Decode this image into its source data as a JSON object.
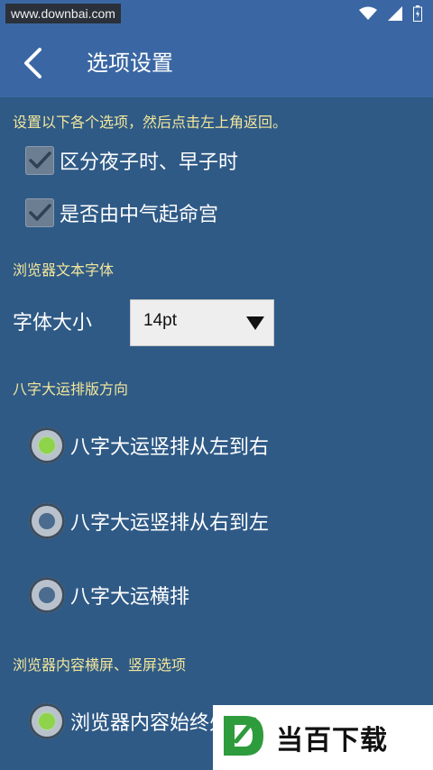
{
  "status_bar": {
    "watermark": "www.downbai.com",
    "icons": [
      "wifi-icon",
      "signal-icon",
      "battery-icon"
    ]
  },
  "app_bar": {
    "back_icon": "chevron-left-icon",
    "title": "选项设置"
  },
  "instruction": "设置以下各个选项，然后点击左上角返回。",
  "checkboxes": [
    {
      "label": "区分夜子时、早子时",
      "checked": true
    },
    {
      "label": "是否由中气起命宫",
      "checked": true
    }
  ],
  "font_section": {
    "title": "浏览器文本字体",
    "size_label": "字体大小",
    "selected_size": "14pt"
  },
  "layout_section": {
    "title": "八字大运排版方向",
    "options": [
      {
        "label": "八字大运竖排从左到右",
        "selected": true
      },
      {
        "label": "八字大运竖排从右到左",
        "selected": false
      },
      {
        "label": "八字大运横排",
        "selected": false
      }
    ]
  },
  "orientation_section": {
    "title": "浏览器内容横屏、竖屏选项",
    "options": [
      {
        "label": "浏览器内容始终处于竖屏",
        "selected": true
      }
    ]
  },
  "watermark_bottom": {
    "text": "当百下载"
  },
  "colors": {
    "background": "#2f5a86",
    "app_bar": "#3a67a3",
    "section_title": "#f3e79b",
    "radio_selected": "#8fd34a"
  }
}
